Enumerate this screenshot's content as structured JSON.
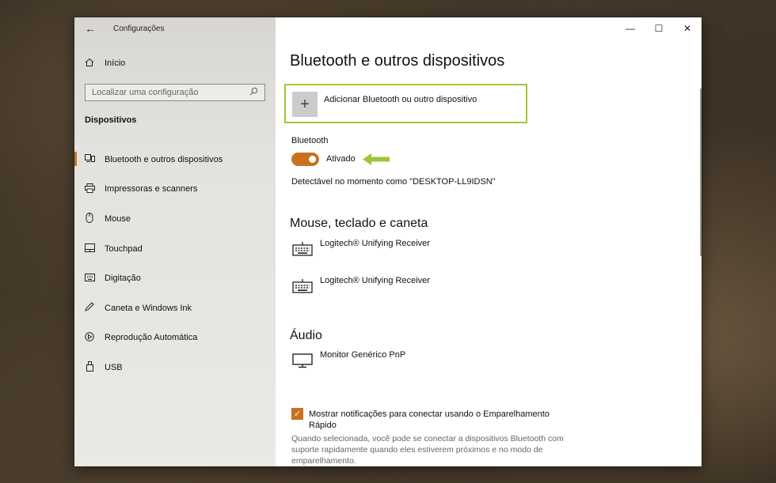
{
  "window": {
    "app_title": "Configurações",
    "back_icon": "arrow-left-icon",
    "controls": {
      "minimize": "—",
      "maximize": "☐",
      "close": "✕"
    }
  },
  "sidebar": {
    "home": {
      "label": "Início",
      "icon": "home-icon"
    },
    "search": {
      "placeholder": "Localizar uma configuração",
      "icon": "search-icon"
    },
    "section_label": "Dispositivos",
    "items": [
      {
        "label": "Bluetooth e outros dispositivos",
        "icon": "bluetooth-devices-icon",
        "active": true
      },
      {
        "label": "Impressoras e scanners",
        "icon": "printer-icon"
      },
      {
        "label": "Mouse",
        "icon": "mouse-icon"
      },
      {
        "label": "Touchpad",
        "icon": "touchpad-icon"
      },
      {
        "label": "Digitação",
        "icon": "keyboard-icon"
      },
      {
        "label": "Caneta e Windows Ink",
        "icon": "pen-icon"
      },
      {
        "label": "Reprodução Automática",
        "icon": "autoplay-icon"
      },
      {
        "label": "USB",
        "icon": "usb-icon"
      }
    ]
  },
  "main": {
    "page_title": "Bluetooth e outros dispositivos",
    "add_device_label": "Adicionar Bluetooth ou outro dispositivo",
    "bluetooth_label": "Bluetooth",
    "bluetooth_state": "Ativado",
    "bluetooth_on": true,
    "discoverable_text": "Detectável no momento como \"DESKTOP-LL9IDSN\"",
    "section_mouse": "Mouse, teclado e caneta",
    "mouse_devices": [
      {
        "name": "Logitech® Unifying Receiver",
        "icon": "keyboard-icon"
      },
      {
        "name": "Logitech® Unifying Receiver",
        "icon": "keyboard-icon"
      }
    ],
    "section_audio": "Áudio",
    "audio_devices": [
      {
        "name": "Monitor Genérico PnP",
        "icon": "monitor-icon"
      }
    ],
    "swift_pair": {
      "checked": true,
      "label": "Mostrar notificações para conectar usando o Emparelhamento Rápido",
      "description": "Quando selecionada, você pode se conectar a dispositivos Bluetooth com suporte rapidamente quando eles estiverem próximos e no modo de emparelhamento."
    }
  },
  "colors": {
    "accent": "#c9711f",
    "highlight": "#9fc634",
    "sidebar_bg": "#e4e2de"
  }
}
